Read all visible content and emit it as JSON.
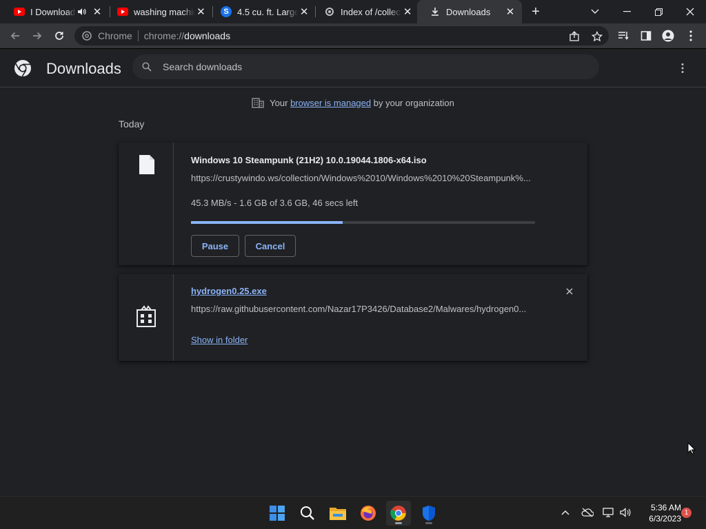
{
  "browser": {
    "tabs": [
      {
        "title": "I Download",
        "favicon": "youtube-icon",
        "audio": true,
        "active": false
      },
      {
        "title": "washing machin",
        "favicon": "youtube-icon",
        "audio": false,
        "active": false
      },
      {
        "title": "4.5 cu. ft. Large",
        "favicon": "s-badge-icon",
        "audio": false,
        "active": false
      },
      {
        "title": "Index of /collect",
        "favicon": "gear-icon",
        "audio": false,
        "active": false
      },
      {
        "title": "Downloads",
        "favicon": "download-icon",
        "audio": false,
        "active": true
      }
    ],
    "omnibox": {
      "chip": "Chrome",
      "scheme": "chrome://",
      "host": "downloads"
    }
  },
  "page": {
    "title": "Downloads",
    "search_placeholder": "Search downloads",
    "managed": {
      "prefix": "Your",
      "link": "browser is managed",
      "suffix": "by your organization"
    },
    "section": "Today",
    "downloads": [
      {
        "name": "Windows 10 Steampunk (21H2) 10.0.19044.1806-x64.iso",
        "url": "https://crustywindo.ws/collection/Windows%2010/Windows%2010%20Steampunk%...",
        "status": "45.3 MB/s - 1.6 GB of 3.6 GB, 46 secs left",
        "progress": 0.44,
        "pause_label": "Pause",
        "cancel_label": "Cancel",
        "icon": "file-icon"
      },
      {
        "name": "hydrogen0.25.exe",
        "url": "https://raw.githubusercontent.com/Nazar17P3426/Database2/Malwares/hydrogen0...",
        "show_label": "Show in folder",
        "icon": "installer-icon"
      }
    ]
  },
  "taskbar": {
    "time": "5:36 AM",
    "date": "6/3/2023",
    "notifications": "1"
  },
  "colors": {
    "accent": "#8ab4f8",
    "background": "#202124",
    "toolbar": "#35363a"
  }
}
